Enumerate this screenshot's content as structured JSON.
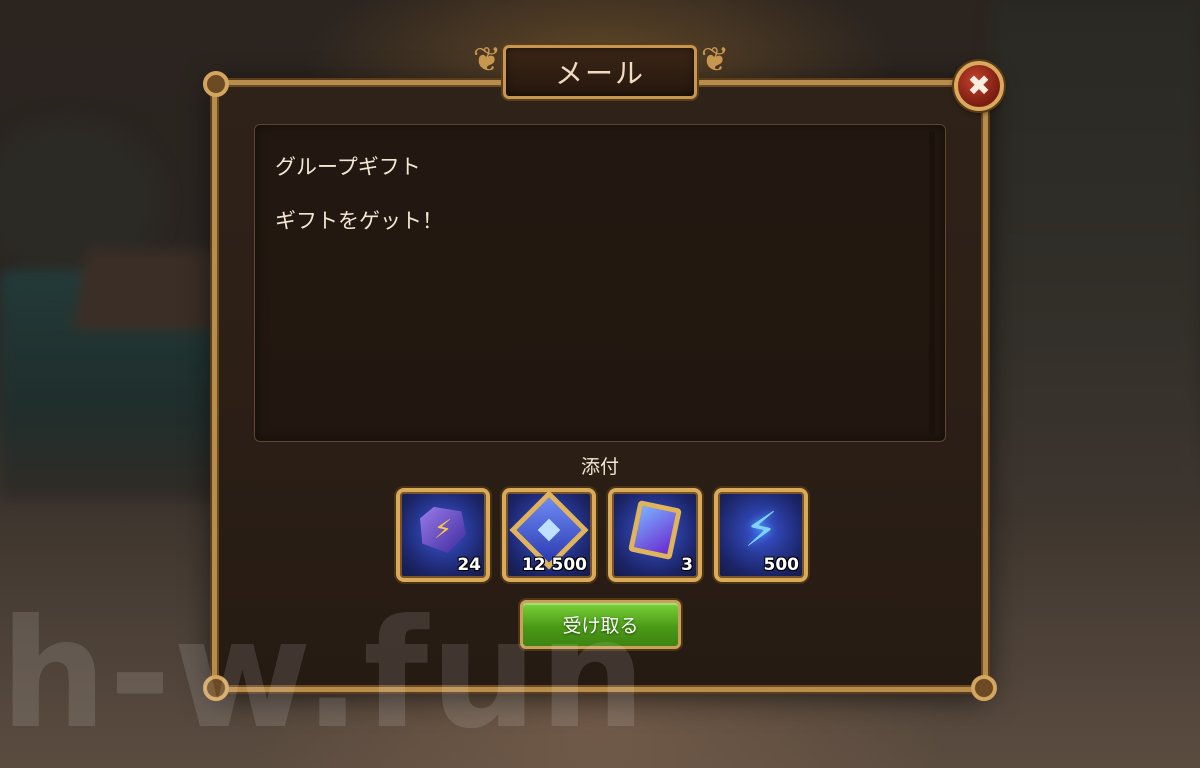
{
  "dialog": {
    "title": "メール",
    "close_label": "✖"
  },
  "message": {
    "subject": "グループギフト",
    "body": "ギフトをゲット！"
  },
  "attachments": {
    "label": "添付",
    "items": [
      {
        "name": "lightning-gem",
        "icon": "lightning-gem-icon",
        "quantity": "24"
      },
      {
        "name": "arena-emblem",
        "icon": "diamond-emblem-icon",
        "quantity": "12 500"
      },
      {
        "name": "card-scroll",
        "icon": "scroll-card-icon",
        "quantity": "3"
      },
      {
        "name": "energy",
        "icon": "lightning-bolt-icon",
        "quantity": "500"
      }
    ]
  },
  "actions": {
    "collect_label": "受け取る"
  },
  "watermark": "h-w.fun",
  "colors": {
    "frame_gold": "#b88c4a",
    "panel_brown": "#2b1f16",
    "button_green": "#4b9a17",
    "close_red": "#a52a1a",
    "item_blue": "#2a3ab0"
  }
}
